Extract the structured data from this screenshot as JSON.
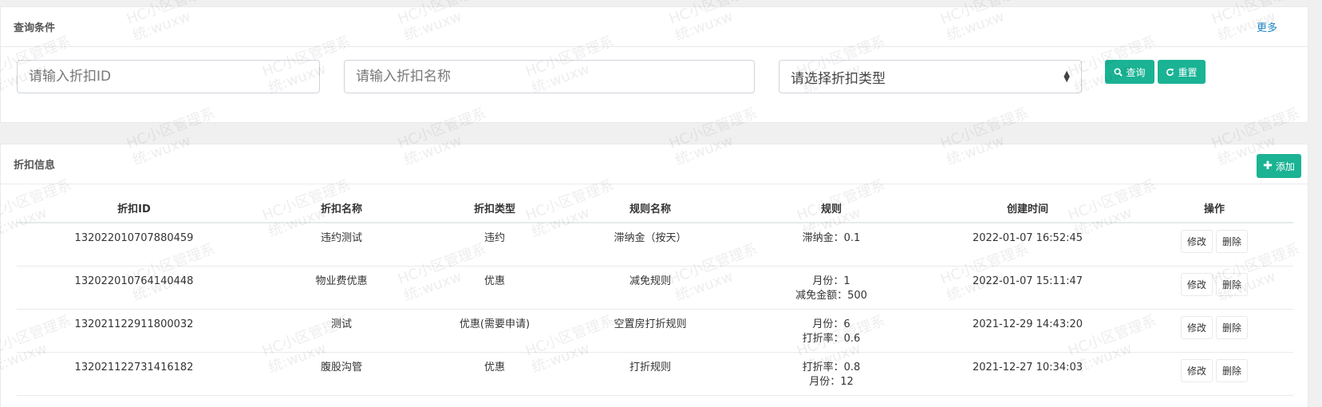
{
  "query": {
    "title": "查询条件",
    "more": "更多",
    "id_placeholder": "请输入折扣ID",
    "name_placeholder": "请输入折扣名称",
    "type_placeholder": "请选择折扣类型",
    "query_label": "查询",
    "reset_label": "重置"
  },
  "info": {
    "title": "折扣信息",
    "add_label": "添加",
    "columns": [
      "折扣ID",
      "折扣名称",
      "折扣类型",
      "规则名称",
      "规则",
      "创建时间",
      "操作"
    ],
    "rows": [
      {
        "id": "132022010707880459",
        "name": "违约测试",
        "type": "违约",
        "rule_name": "滞纳金（按天）",
        "rules": [
          "滞纳金：0.1"
        ],
        "created": "2022-01-07 16:52:45"
      },
      {
        "id": "132022010764140448",
        "name": "物业费优惠",
        "type": "优惠",
        "rule_name": "减免规则",
        "rules": [
          "月份：1",
          "减免金额：500"
        ],
        "created": "2022-01-07 15:11:47"
      },
      {
        "id": "132021122911800032",
        "name": "测试",
        "type": "优惠(需要申请)",
        "rule_name": "空置房打折规则",
        "rules": [
          "月份：6",
          "打折率：0.6"
        ],
        "created": "2021-12-29 14:43:20"
      },
      {
        "id": "132021122731416182",
        "name": "腹股沟管",
        "type": "优惠",
        "rule_name": "打折规则",
        "rules": [
          "打折率：0.8",
          "月份：12"
        ],
        "created": "2021-12-27 10:34:03"
      }
    ],
    "edit_label": "修改",
    "delete_label": "删除"
  },
  "watermark": {
    "line1": "HC小区管理系",
    "line2": "统:wuxw"
  },
  "colors": {
    "primary": "#1ab394",
    "link": "#1c84c6",
    "border": "#e7eaec",
    "background": "#f0f0f0"
  }
}
